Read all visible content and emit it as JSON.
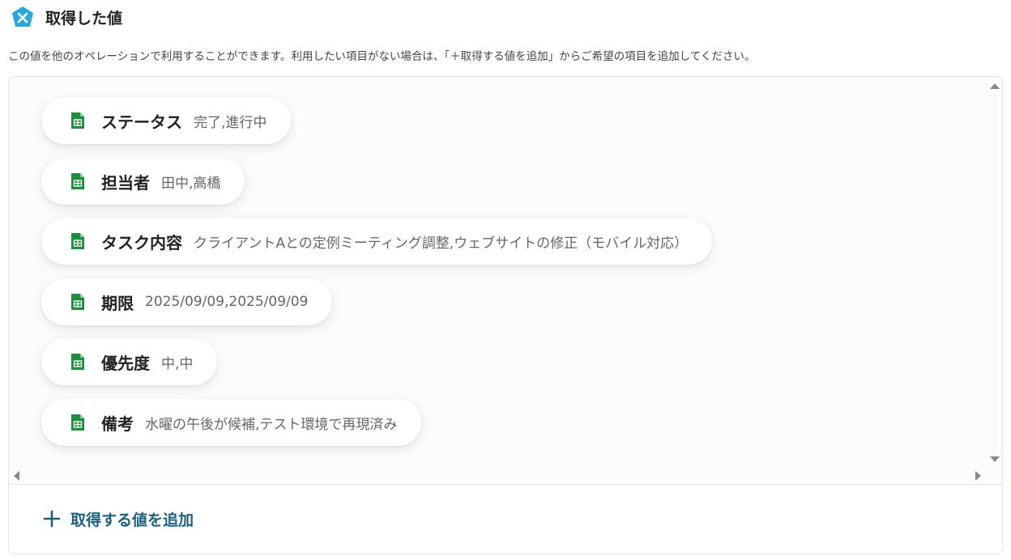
{
  "header": {
    "icon": "yoom-logo-icon",
    "title": "取得した値"
  },
  "description": "この値を他のオペレーションで利用することができます。利用したい項目がない場合は、「＋取得する値を追加」からご希望の項目を追加してください。",
  "colors": {
    "accent": "#1e5f7f",
    "logo": "#29a8e0",
    "sheet_icon": "#1e8e3e"
  },
  "fields": [
    {
      "label": "ステータス",
      "value": "完了,進行中",
      "icon": "google-sheets-icon"
    },
    {
      "label": "担当者",
      "value": "田中,高橋",
      "icon": "google-sheets-icon"
    },
    {
      "label": "タスク内容",
      "value": "クライアントAとの定例ミーティング調整,ウェブサイトの修正（モバイル対応）",
      "icon": "google-sheets-icon"
    },
    {
      "label": "期限",
      "value": "2025/09/09,2025/09/09",
      "icon": "google-sheets-icon"
    },
    {
      "label": "優先度",
      "value": "中,中",
      "icon": "google-sheets-icon"
    },
    {
      "label": "備考",
      "value": "水曜の午後が候補,テスト環境で再現済み",
      "icon": "google-sheets-icon"
    }
  ],
  "add_button": {
    "icon": "plus-icon",
    "label": "取得する値を追加"
  }
}
